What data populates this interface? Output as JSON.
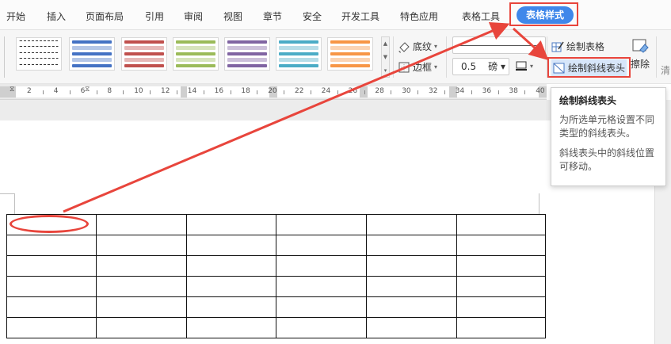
{
  "menu": {
    "tabs": [
      "开始",
      "插入",
      "页面布局",
      "引用",
      "审阅",
      "视图",
      "章节",
      "安全",
      "开发工具",
      "特色应用",
      "表格工具",
      "表格样式"
    ]
  },
  "ribbon": {
    "shading_label": "底纹",
    "border_label": "边框",
    "line_width_value": "0.5",
    "line_width_unit": "磅",
    "draw_table_label": "绘制表格",
    "draw_diagonal_label": "绘制斜线表头",
    "erase_label": "擦除",
    "cut_off_label": "清"
  },
  "ruler": {
    "numbers": [
      "2",
      "4",
      "6",
      "8",
      "10",
      "12",
      "14",
      "16",
      "18",
      "20",
      "22",
      "24",
      "26",
      "28",
      "30",
      "32",
      "34",
      "36",
      "38",
      "40"
    ]
  },
  "tooltip": {
    "title": "绘制斜线表头",
    "desc": "为所选单元格设置不同类型的斜线表头。",
    "note": "斜线表头中的斜线位置可移动。"
  },
  "colors": {
    "active_tab": "#3f87ea",
    "annotation_red": "#e8453c",
    "swatches": [
      "#ffffff",
      "#4472c4",
      "#c0504d",
      "#9bbb59",
      "#8064a2",
      "#4bacc6",
      "#f79646"
    ]
  },
  "icons": [
    "shading-icon",
    "border-icon",
    "draw-table-icon",
    "draw-diagonal-icon",
    "eraser-icon",
    "line-color-icon",
    "gallery-scroll-icon"
  ]
}
